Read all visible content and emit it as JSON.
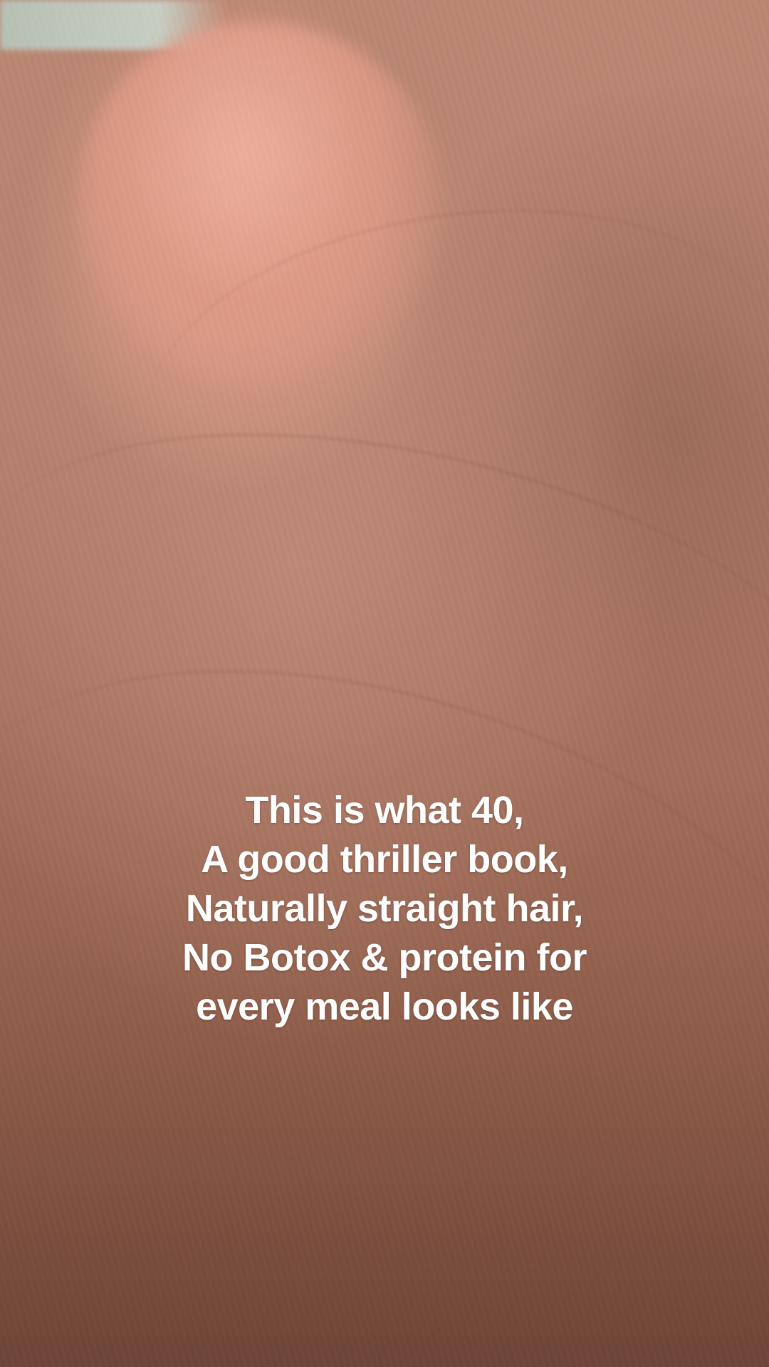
{
  "caption": {
    "lines": [
      "This is what 40,",
      "A good thriller book,",
      "Naturally straight hair,",
      "No Botox & protein for",
      "every meal looks like"
    ]
  }
}
